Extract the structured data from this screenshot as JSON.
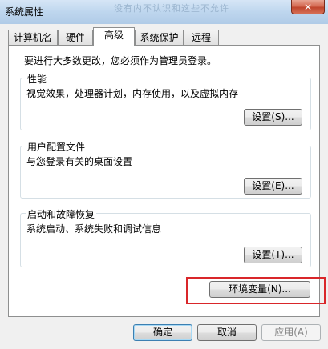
{
  "window": {
    "title": "系统属性",
    "ghost_text": "没有内不认识和这些不允许"
  },
  "title_bar": {
    "close_glyph": "✕"
  },
  "tabs": [
    {
      "label": "计算机名",
      "active": false
    },
    {
      "label": "硬件",
      "active": false
    },
    {
      "label": "高级",
      "active": true
    },
    {
      "label": "系统保护",
      "active": false
    },
    {
      "label": "远程",
      "active": false
    }
  ],
  "advanced": {
    "admin_note": "要进行大多数更改，您必须作为管理员登录。",
    "performance": {
      "title": "性能",
      "description": "视觉效果，处理器计划，内存使用，以及虚拟内存",
      "button": "设置(S)..."
    },
    "user_profiles": {
      "title": "用户配置文件",
      "description": "与您登录有关的桌面设置",
      "button": "设置(E)..."
    },
    "startup_recovery": {
      "title": "启动和故障恢复",
      "description": "系统启动、系统失败和调试信息",
      "button": "设置(T)..."
    },
    "env_button": "环境变量(N)..."
  },
  "footer": {
    "ok": "确定",
    "cancel": "取消",
    "apply": "应用(A)"
  },
  "colors": {
    "highlight": "#d9262a",
    "window_bg": "#f0f0f0",
    "panel_bg": "#ffffff"
  }
}
